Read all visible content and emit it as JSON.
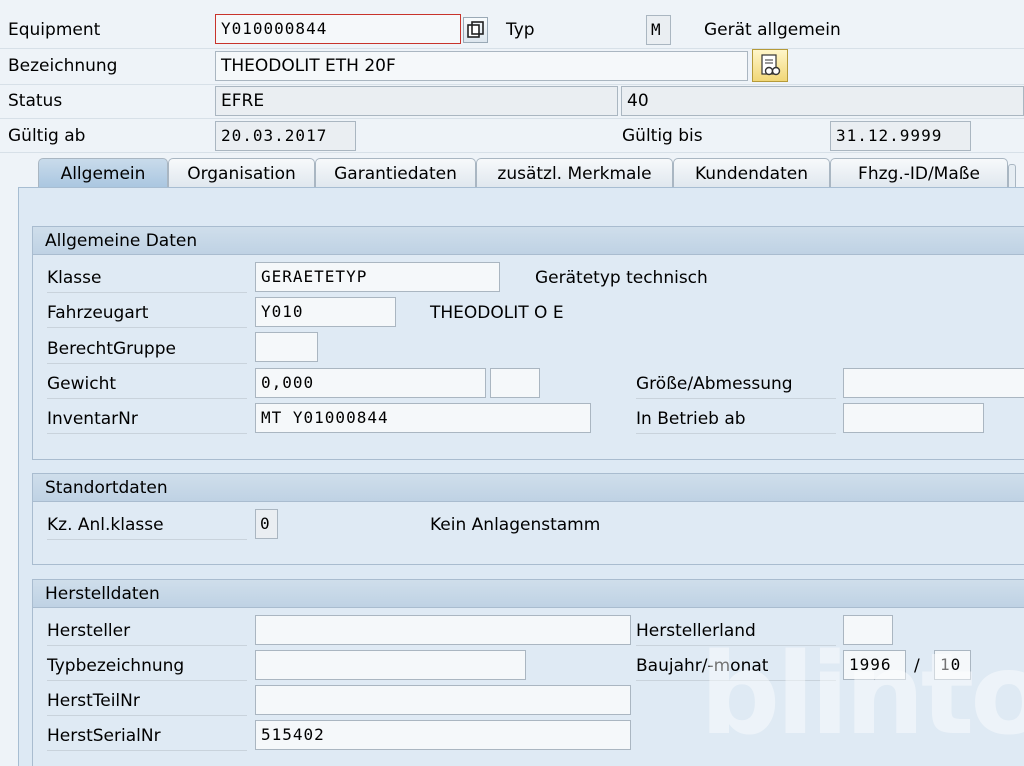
{
  "header": {
    "equipment_label": "Equipment",
    "equipment_value": "Y010000844",
    "typ_label": "Typ",
    "typ_value": "M",
    "typ_text": "Gerät allgemein",
    "bezeichnung_label": "Bezeichnung",
    "bezeichnung_value": "THEODOLIT ETH 20F",
    "status_label": "Status",
    "status_value": "EFRE",
    "status_value2": "40",
    "gueltig_ab_label": "Gültig ab",
    "gueltig_ab_value": "20.03.2017",
    "gueltig_bis_label": "Gültig bis",
    "gueltig_bis_value": "31.12.9999"
  },
  "tabs": [
    {
      "label": "Allgemein",
      "active": true
    },
    {
      "label": "Organisation"
    },
    {
      "label": "Garantiedaten"
    },
    {
      "label": "zusätzl. Merkmale"
    },
    {
      "label": "Kundendaten"
    },
    {
      "label": "Fhzg.-ID/Maße"
    }
  ],
  "allgemeine_daten": {
    "title": "Allgemeine Daten",
    "klasse_label": "Klasse",
    "klasse_value": "GERAETETYP",
    "klasse_text": "Gerätetyp technisch",
    "fahrzeugart_label": "Fahrzeugart",
    "fahrzeugart_value": "Y010",
    "fahrzeugart_text": "THEODOLIT O E",
    "berecht_label": "BerechtGruppe",
    "berecht_value": "",
    "gewicht_label": "Gewicht",
    "gewicht_value": "0,000",
    "gewicht_unit": "",
    "groesse_label": "Größe/Abmessung",
    "groesse_value": "",
    "inventar_label": "InventarNr",
    "inventar_value": "MT Y01000844",
    "in_betrieb_label": "In Betrieb ab",
    "in_betrieb_value": ""
  },
  "standortdaten": {
    "title": "Standortdaten",
    "kz_label": "Kz. Anl.klasse",
    "kz_value": "0",
    "kz_text": "Kein Anlagenstamm"
  },
  "herstelldaten": {
    "title": "Herstelldaten",
    "hersteller_label": "Hersteller",
    "hersteller_value": "",
    "herstellerland_label": "Herstellerland",
    "herstellerland_value": "",
    "typbez_label": "Typbezeichnung",
    "typbez_value": "",
    "baujahr_label": "Baujahr/-monat",
    "baujahr_value": "1996",
    "baujahr_sep": "/",
    "baumonat_value": "10",
    "teilnr_label": "HerstTeilNr",
    "teilnr_value": "",
    "serialnr_label": "HerstSerialNr",
    "serialnr_value": "515402"
  },
  "watermark": "blinto"
}
